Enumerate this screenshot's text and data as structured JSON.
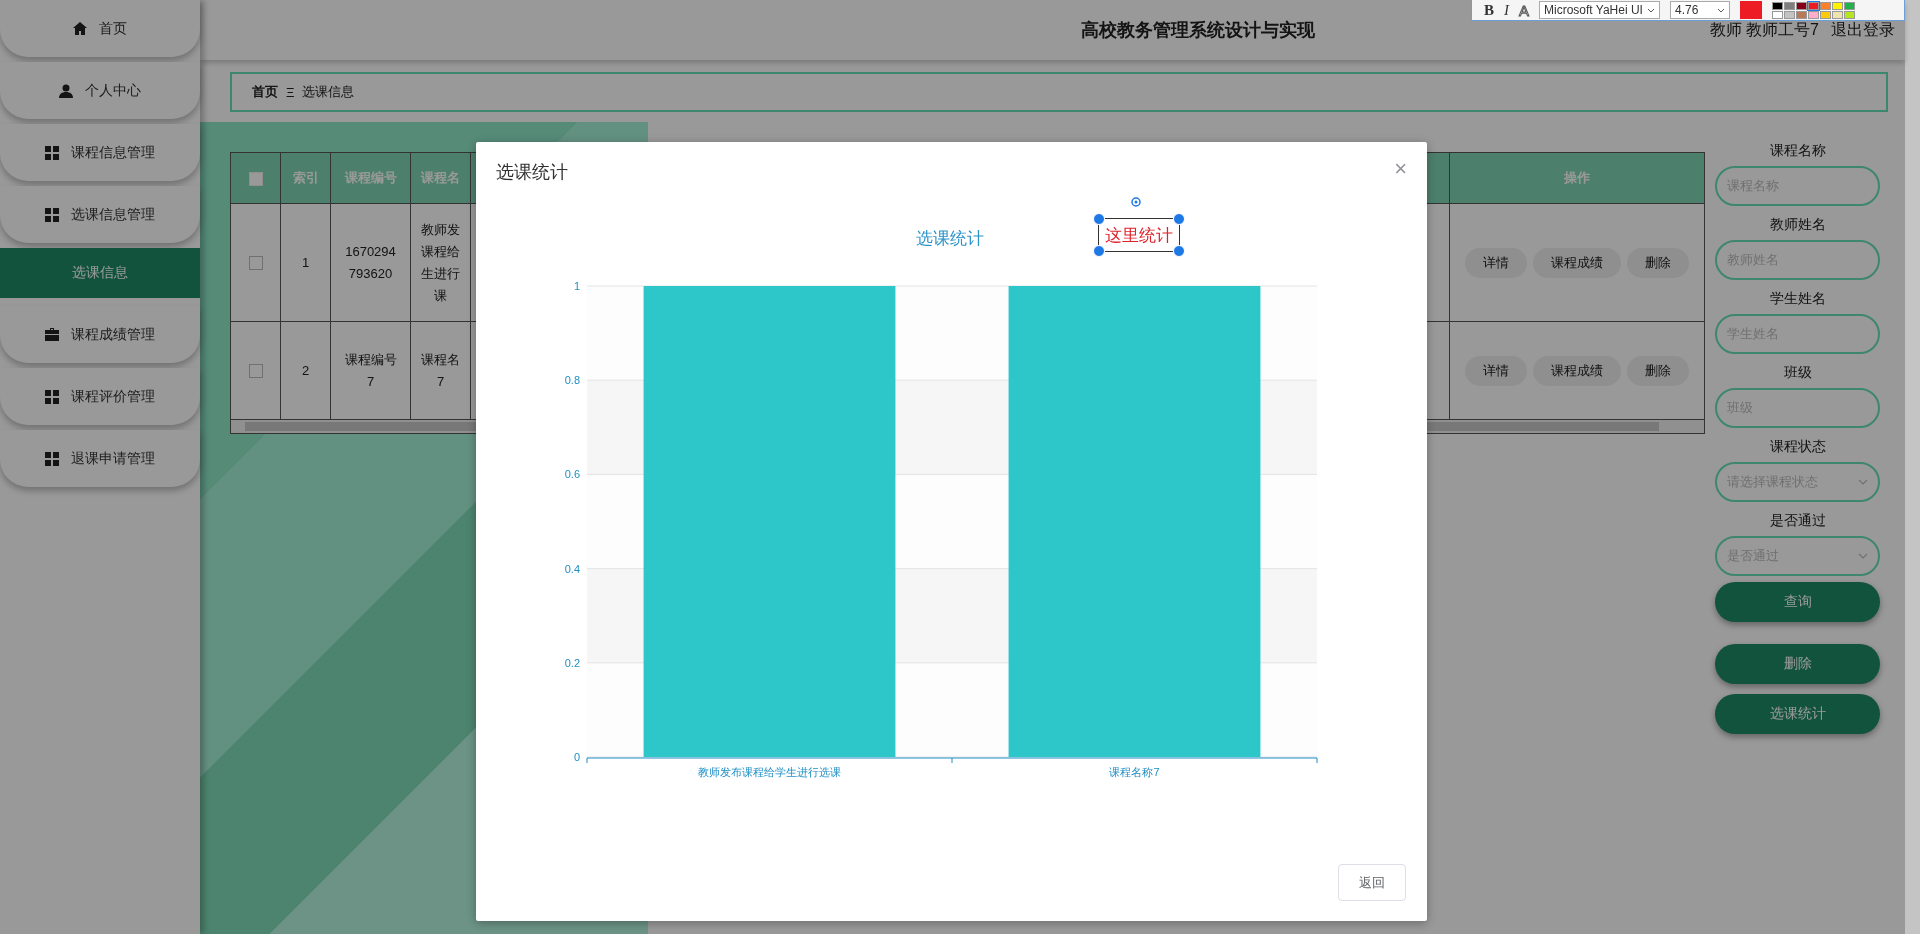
{
  "editor_toolbar": {
    "bold": "B",
    "italic": "I",
    "outline": "A",
    "font": "Microsoft YaHei UI",
    "size": "4.76",
    "swatches": [
      {
        "color": "#000000",
        "selected": false
      },
      {
        "color": "#7f7f7f",
        "selected": false
      },
      {
        "color": "#880015",
        "selected": false
      },
      {
        "color": "#ed1c24",
        "selected": true
      },
      {
        "color": "#ff7f27",
        "selected": false
      },
      {
        "color": "#fff200",
        "selected": false
      },
      {
        "color": "#22b14c",
        "selected": false
      },
      {
        "color": "#ffffff",
        "selected": false
      },
      {
        "color": "#c3c3c3",
        "selected": false
      },
      {
        "color": "#b97a57",
        "selected": false
      },
      {
        "color": "#ffaec9",
        "selected": false
      },
      {
        "color": "#ffc90e",
        "selected": false
      },
      {
        "color": "#efe4b0",
        "selected": false
      },
      {
        "color": "#b5e61d",
        "selected": false
      }
    ]
  },
  "sidebar": {
    "items": [
      {
        "kind": "home",
        "label": "首页",
        "selected": false
      },
      {
        "kind": "person",
        "label": "个人中心",
        "selected": false
      },
      {
        "kind": "grid",
        "label": "课程信息管理",
        "selected": false
      },
      {
        "kind": "grid",
        "label": "选课信息管理",
        "selected": false
      },
      {
        "kind": "sub",
        "label": "选课信息",
        "selected": true
      },
      {
        "kind": "case",
        "label": "课程成绩管理",
        "selected": false
      },
      {
        "kind": "grid",
        "label": "课程评价管理",
        "selected": false
      },
      {
        "kind": "grid",
        "label": "退课申请管理",
        "selected": false
      }
    ]
  },
  "header": {
    "title": "高校教务管理系统设计与实现",
    "user": "教师 教师工号7",
    "logout": "退出登录"
  },
  "breadcrumb": {
    "home": "首页",
    "separator": "Ξ",
    "current": "选课信息"
  },
  "table": {
    "select_all": false,
    "columns": [
      "索引",
      "课程编号",
      "课程名",
      "操作"
    ],
    "rows": [
      {
        "checked": false,
        "cells": [
          [
            "1"
          ],
          [
            "1670294",
            "793620"
          ],
          [
            "教师发",
            "课程给",
            "生进行",
            "课"
          ]
        ],
        "actions": [
          "详情",
          "课程成绩",
          "删除"
        ]
      },
      {
        "checked": false,
        "cells": [
          [
            "2"
          ],
          [
            "课程编号",
            "7"
          ],
          [
            "课程名",
            "7"
          ]
        ],
        "actions": [
          "详情",
          "课程成绩",
          "删除"
        ]
      }
    ]
  },
  "search": {
    "fields": [
      {
        "kind": "text",
        "label": "课程名称",
        "placeholder": "课程名称"
      },
      {
        "kind": "text",
        "label": "教师姓名",
        "placeholder": "教师姓名"
      },
      {
        "kind": "text",
        "label": "学生姓名",
        "placeholder": "学生姓名"
      },
      {
        "kind": "text",
        "label": "班级",
        "placeholder": "班级"
      },
      {
        "kind": "select",
        "label": "课程状态",
        "placeholder": "请选择课程状态"
      },
      {
        "kind": "select",
        "label": "是否通过",
        "placeholder": "是否通过"
      }
    ],
    "buttons": [
      "查询",
      "删除",
      "选课统计"
    ]
  },
  "modal": {
    "title": "选课统计",
    "close": "×",
    "annotation": {
      "text": "这里统计"
    },
    "buttons": [
      "返回"
    ],
    "chart_data": {
      "type": "bar",
      "title": "选课统计",
      "categories": [
        "教师发布课程给学生进行选课",
        "课程名称7"
      ],
      "values": [
        1,
        1
      ],
      "ylim": [
        0,
        1
      ],
      "grid": true,
      "yticks": [
        0,
        0.2,
        0.4,
        0.6,
        0.8,
        1
      ]
    }
  }
}
